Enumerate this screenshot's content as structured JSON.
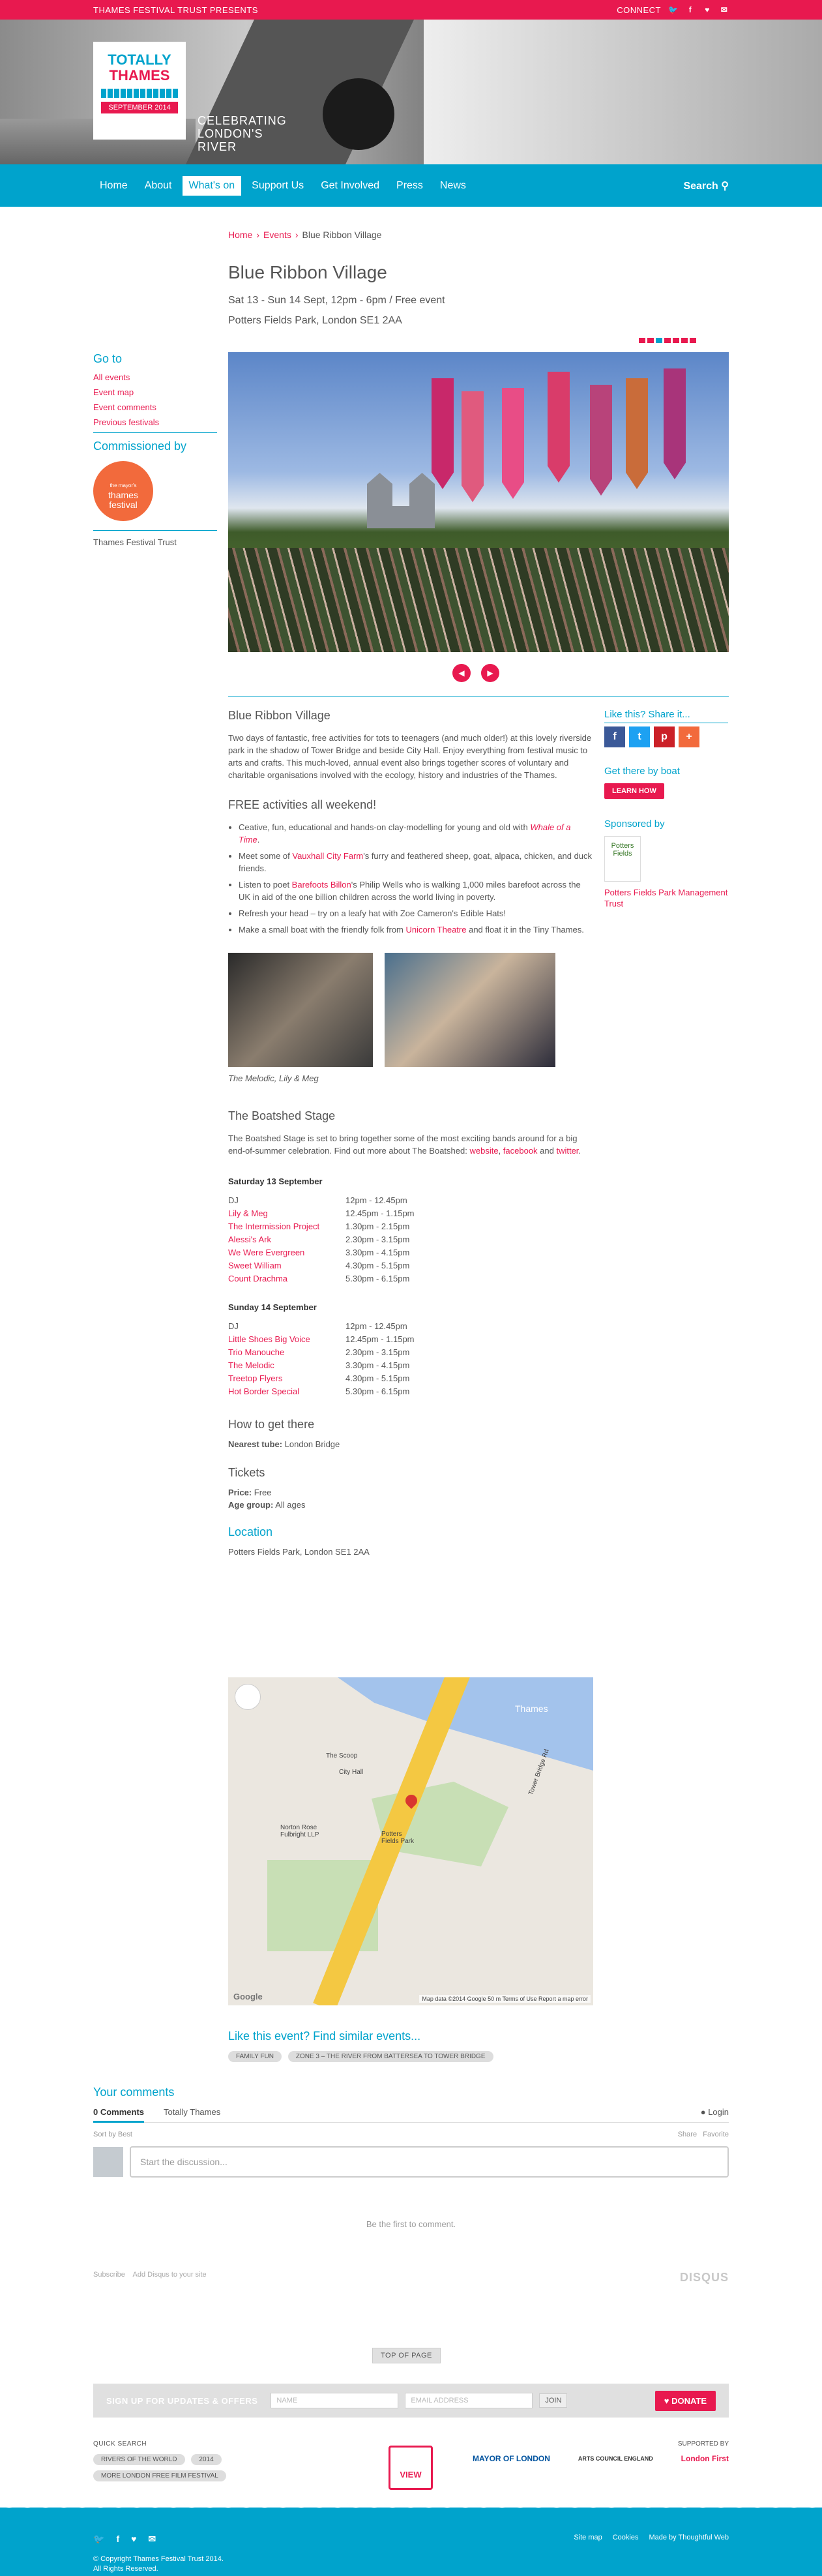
{
  "topbar": {
    "org": "THAMES FESTIVAL TRUST PRESENTS",
    "connect": "CONNECT"
  },
  "logo": {
    "line1": "TOTALLY",
    "line2": "THAMES",
    "date": "SEPTEMBER 2014"
  },
  "tagline": {
    "line1": "CELEBRATING",
    "line2": "LONDON'S",
    "line3": "RIVER"
  },
  "nav": {
    "items": [
      "Home",
      "About",
      "What's on",
      "Support Us",
      "Get Involved",
      "Press",
      "News"
    ],
    "active": "What's on",
    "search": "Search"
  },
  "breadcrumb": {
    "home": "Home",
    "events": "Events",
    "current": "Blue Ribbon Village"
  },
  "event": {
    "title": "Blue Ribbon Village",
    "dates": "Sat 13 - Sun 14 Sept, 12pm - 6pm / Free event",
    "venue": "Potters Fields Park, London SE1 2AA"
  },
  "sidebar": {
    "goto": "Go to",
    "links": [
      "All events",
      "Event map",
      "Event comments",
      "Previous festivals"
    ],
    "commissioned": "Commissioned by",
    "badge_small": "the mayor's",
    "badge": "thames festival",
    "trust": "Thames Festival Trust"
  },
  "main": {
    "heading": "Blue Ribbon Village",
    "intro": "Two days of fantastic, free activities for tots to teenagers (and much older!) at this lovely riverside park in the shadow of Tower Bridge and beside City Hall. Enjoy everything from festival music to arts and crafts. This much-loved, annual event also brings together scores of voluntary and charitable organisations involved with the ecology, history and industries of the Thames.",
    "free_heading": "FREE activities all weekend!",
    "b1a": "Ceative, fun, educational and hands-on clay-modelling for young and old with ",
    "b1link": "Whale of a Time",
    "b1b": ".",
    "b2a": "Meet some of ",
    "b2link": "Vauxhall City Farm",
    "b2b": "'s furry and feathered sheep, goat, alpaca, chicken, and duck friends.",
    "b3a": "Listen to poet ",
    "b3link": "Barefoots Billon",
    "b3b": "'s Philip Wells who is walking 1,000 miles barefoot across the UK in aid of the one billion children across the world living in poverty.",
    "b4": "Refresh your head – try on a leafy hat with Zoe Cameron's Edible Hats!",
    "b5a": "Make a small boat with the friendly folk from ",
    "b5link": "Unicorn Theatre",
    "b5b": " and float it in the Tiny Thames.",
    "caption": "The Melodic, Lily & Meg",
    "stage_heading": "The Boatshed Stage",
    "stage_text": "The Boatshed Stage is set to bring together some of the most exciting bands around for a big end-of-summer celebration. Find out more about The Boatshed: ",
    "stage_website": "website",
    "stage_comma": ", ",
    "stage_facebook": "facebook",
    "stage_and": " and ",
    "stage_twitter": "twitter",
    "stage_end": ".",
    "sat_heading": "Saturday 13 September",
    "sat": [
      {
        "band": "DJ",
        "time": "12pm - 12.45pm",
        "link": false
      },
      {
        "band": "Lily & Meg",
        "time": "12.45pm - 1.15pm",
        "link": true
      },
      {
        "band": "The Intermission Project",
        "time": "1.30pm - 2.15pm",
        "link": true
      },
      {
        "band": "Alessi's Ark",
        "time": "2.30pm - 3.15pm",
        "link": true
      },
      {
        "band": "We Were Evergreen",
        "time": "3.30pm - 4.15pm",
        "link": true
      },
      {
        "band": "Sweet William",
        "time": "4.30pm - 5.15pm",
        "link": true
      },
      {
        "band": "Count Drachma",
        "time": "5.30pm - 6.15pm",
        "link": true
      }
    ],
    "sun_heading": "Sunday 14 September",
    "sun": [
      {
        "band": "DJ",
        "time": "12pm - 12.45pm",
        "link": false
      },
      {
        "band": "Little Shoes Big Voice",
        "time": "12.45pm - 1.15pm",
        "link": true
      },
      {
        "band": "Trio Manouche",
        "time": "2.30pm - 3.15pm",
        "link": true
      },
      {
        "band": "The Melodic",
        "time": "3.30pm - 4.15pm",
        "link": true
      },
      {
        "band": "Treetop Flyers",
        "time": "4.30pm - 5.15pm",
        "link": true
      },
      {
        "band": "Hot Border Special",
        "time": "5.30pm - 6.15pm",
        "link": true
      }
    ],
    "howto_heading": "How to get there",
    "tube_label": "Nearest tube:",
    "tube": " London Bridge",
    "tickets_heading": "Tickets",
    "price_label": "Price:",
    "price": " Free",
    "age_label": "Age group:",
    "age": " All ages",
    "location_heading": "Location",
    "location": "Potters Fields Park, London SE1 2AA"
  },
  "map": {
    "scoop": "The Scoop",
    "cityhall": "City Hall",
    "norton": "Norton Rose Fulbright LLP",
    "park": "Potters Fields Park",
    "bridge_road": "Tower Bridge Rd",
    "thames": "Thames",
    "credit": "Map data ©2014 Google   50 m   Terms of Use   Report a map error",
    "google": "Google"
  },
  "right": {
    "like": "Like this? Share it...",
    "boat": "Get there by boat",
    "learn": "LEARN HOW",
    "sponsored": "Sponsored by",
    "sponsor_logo": "Potters Fields",
    "sponsor": "Potters Fields Park Management Trust"
  },
  "similar": {
    "heading": "Like this event? Find similar events...",
    "tags": [
      "FAMILY FUN",
      "ZONE 3 – THE RIVER FROM BATTERSEA TO TOWER BRIDGE"
    ]
  },
  "comments": {
    "heading": "Your comments",
    "tab1": "0 Comments",
    "tab2": "Totally Thames",
    "login": "Login",
    "sort": "Sort by Best",
    "share": "Share",
    "favorite": "Favorite",
    "placeholder": "Start the discussion...",
    "empty": "Be the first to comment.",
    "subscribe": "Subscribe",
    "add": "Add Disqus to your site",
    "disqus": "DISQUS"
  },
  "totop": "TOP OF PAGE",
  "signup": {
    "label": "SIGN UP FOR UPDATES & OFFERS",
    "name": "NAME",
    "email": "EMAIL ADDRESS",
    "join": "JOIN",
    "donate": "DONATE"
  },
  "quicksearch": {
    "heading": "QUICK SEARCH",
    "tags": [
      "RIVERS OF THE WORLD",
      "2014",
      "MORE LONDON FREE FILM FESTIVAL"
    ]
  },
  "calendar": {
    "label": "VIEW"
  },
  "supported": {
    "heading": "SUPPORTED BY",
    "mayor": "MAYOR OF LONDON",
    "arts": "ARTS COUNCIL ENGLAND",
    "london": "London First"
  },
  "footer": {
    "links": [
      "Site map",
      "Cookies",
      "Made by Thoughtful Web"
    ],
    "copy1": "© Copyright Thames Festival Trust 2014.",
    "copy2": "All Rights Reserved."
  },
  "colors": {
    "accent": "#e8194f",
    "brand": "#00a3cc"
  }
}
